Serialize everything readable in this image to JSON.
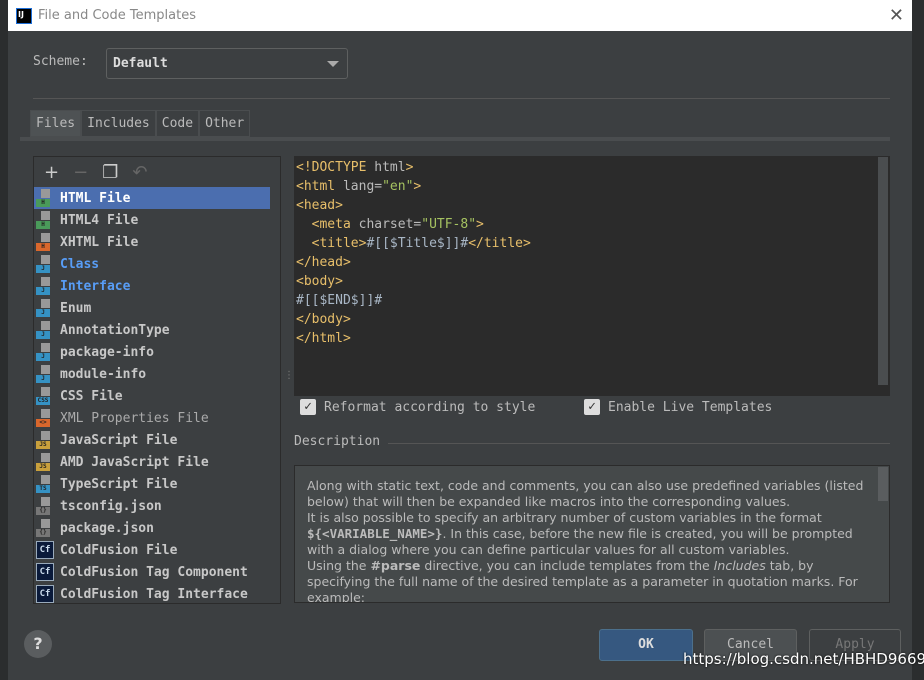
{
  "window": {
    "title": "File and Code Templates",
    "logo": "IJ"
  },
  "scheme": {
    "label": "Scheme:",
    "value": "Default"
  },
  "tabs": [
    {
      "label": "Files",
      "selected": true
    },
    {
      "label": "Includes"
    },
    {
      "label": "Code"
    },
    {
      "label": "Other"
    }
  ],
  "toolbar": {
    "icons": [
      "plus-icon",
      "minus-icon",
      "copy-icon",
      "revert-icon"
    ]
  },
  "files": [
    {
      "name": "HTML File",
      "badge": "H",
      "badgeColor": "#4a9a5a",
      "selected": true
    },
    {
      "name": "HTML4 File",
      "badge": "H",
      "badgeColor": "#4a9a5a"
    },
    {
      "name": "XHTML File",
      "badge": "H",
      "badgeColor": "#d9672c"
    },
    {
      "name": "Class",
      "badge": "J",
      "badgeColor": "#3592c4",
      "color": "#589df6"
    },
    {
      "name": "Interface",
      "badge": "J",
      "badgeColor": "#3592c4",
      "color": "#589df6"
    },
    {
      "name": "Enum",
      "badge": "J",
      "badgeColor": "#3592c4"
    },
    {
      "name": "AnnotationType",
      "badge": "J",
      "badgeColor": "#3592c4"
    },
    {
      "name": "package-info",
      "badge": "J",
      "badgeColor": "#3592c4"
    },
    {
      "name": "module-info",
      "badge": "J",
      "badgeColor": "#3592c4"
    },
    {
      "name": "CSS File",
      "badge": "CSS",
      "badgeColor": "#3592c4"
    },
    {
      "name": "XML Properties File",
      "badge": "<>",
      "badgeColor": "#d9672c",
      "regular": true
    },
    {
      "name": "JavaScript File",
      "badge": "JS",
      "badgeColor": "#c9a03c"
    },
    {
      "name": "AMD JavaScript File",
      "badge": "JS",
      "badgeColor": "#c9a03c"
    },
    {
      "name": "TypeScript File",
      "badge": "TS",
      "badgeColor": "#3592c4"
    },
    {
      "name": "tsconfig.json",
      "badge": "{}",
      "badgeColor": "#777"
    },
    {
      "name": "package.json",
      "badge": "{}",
      "badgeColor": "#777"
    },
    {
      "name": "ColdFusion File",
      "badge": "Cf",
      "cf": true
    },
    {
      "name": "ColdFusion Tag Component",
      "badge": "Cf",
      "cf": true
    },
    {
      "name": "ColdFusion Tag Interface",
      "badge": "Cf",
      "cf": true
    }
  ],
  "editor": {
    "lines": [
      [
        [
          "tag",
          "<!DOCTYPE "
        ],
        [
          "attr",
          "html"
        ],
        [
          "tag",
          ">"
        ]
      ],
      [
        [
          "tag",
          "<html "
        ],
        [
          "attr",
          "lang="
        ],
        [
          "val",
          "\"en\""
        ],
        [
          "tag",
          ">"
        ]
      ],
      [
        [
          "tag",
          "<head>"
        ]
      ],
      [
        [
          "txt",
          "  "
        ],
        [
          "tag",
          "<meta "
        ],
        [
          "attr",
          "charset="
        ],
        [
          "val",
          "\"UTF-8\""
        ],
        [
          "tag",
          ">"
        ]
      ],
      [
        [
          "txt",
          "  "
        ],
        [
          "tag",
          "<title>"
        ],
        [
          "txt",
          "#[[$Title$]]#"
        ],
        [
          "tag",
          "</title>"
        ]
      ],
      [
        [
          "tag",
          "</head>"
        ]
      ],
      [
        [
          "tag",
          "<body>"
        ]
      ],
      [
        [
          "txt",
          "#[[$END$]]#"
        ]
      ],
      [
        [
          "tag",
          "</body>"
        ]
      ],
      [
        [
          "tag",
          "</html>"
        ]
      ]
    ]
  },
  "options": {
    "reformat": {
      "label": "Reformat according to style",
      "checked": true
    },
    "live": {
      "label": "Enable Live Templates",
      "checked": true
    }
  },
  "description": {
    "label": "Description",
    "html": "Along with static text, code and comments, you can also use predefined variables (listed below) that will then be expanded like macros into the corresponding values.<br>It is also possible to specify an arbitrary number of custom variables in the format <b style=\"font-family:'DejaVu Sans Mono',monospace\">${&lt;VARIABLE_NAME&gt;}</b>. In this case, before the new file is created, you will be prompted with a dialog where you can define particular values for all custom variables.<br>Using the <b>#parse</b> directive, you can include templates from the <i>Includes</i> tab, by specifying the full name of the desired template as a parameter in quotation marks. For example:"
  },
  "buttons": {
    "ok": "OK",
    "cancel": "Cancel",
    "apply": "Apply",
    "help": "?"
  },
  "watermark": "https://blog.csdn.net/HBHD9669"
}
